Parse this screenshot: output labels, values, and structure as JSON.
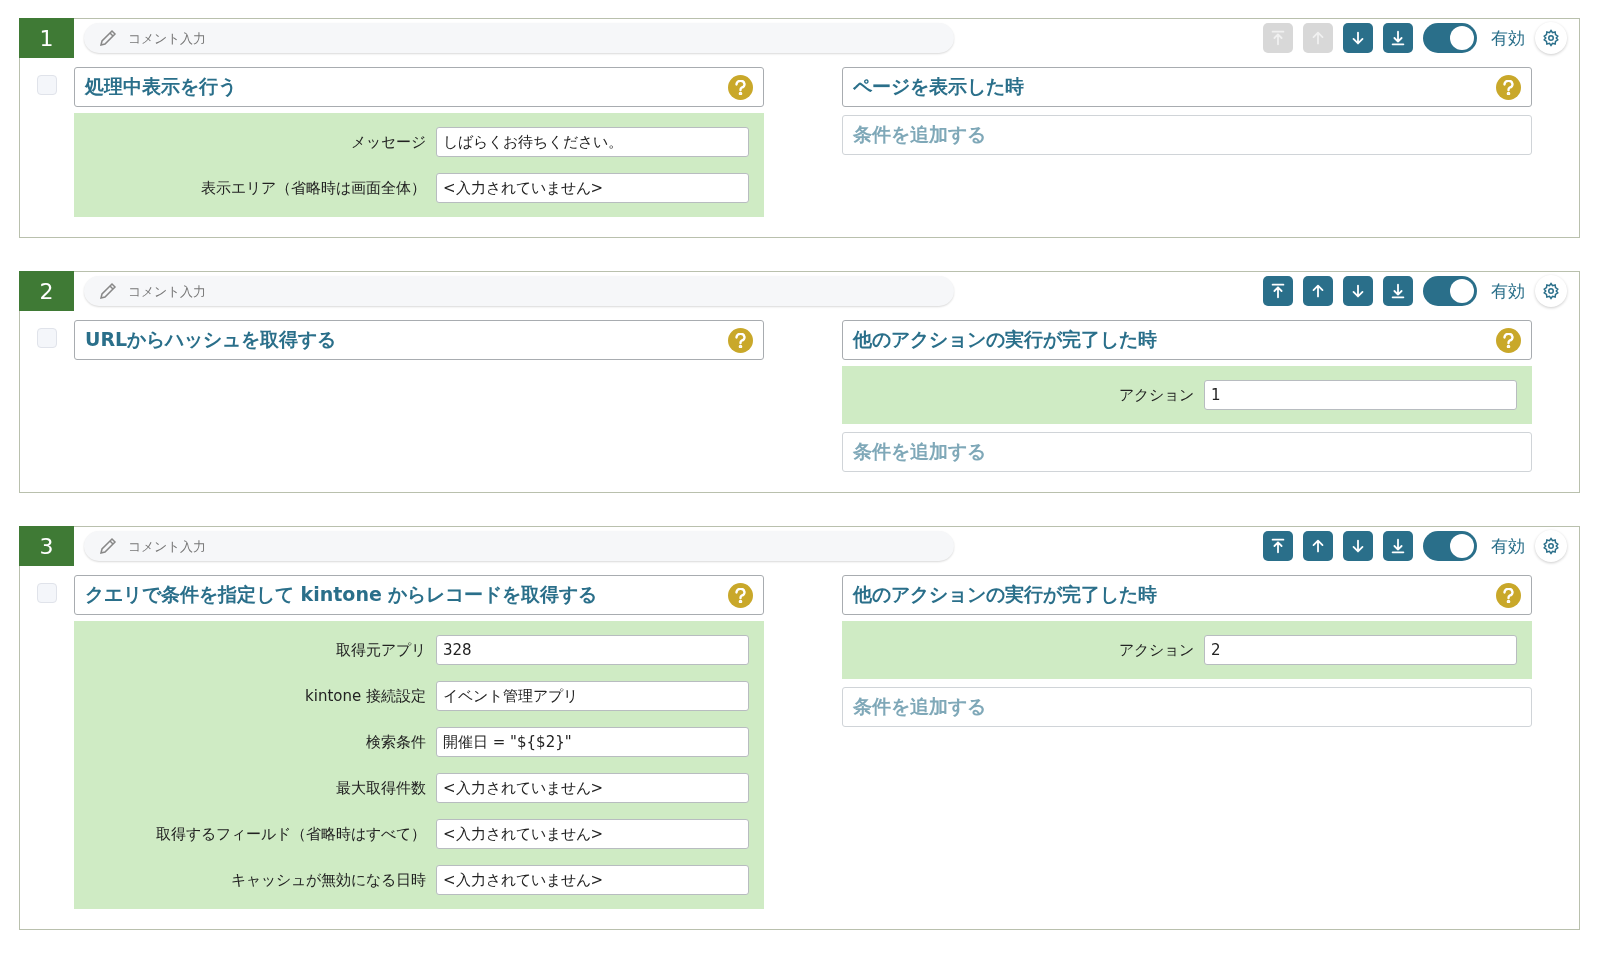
{
  "rules": [
    {
      "number": "1",
      "comment": {
        "placeholder": "コメント入力"
      },
      "move_buttons": [
        {
          "kind": "top",
          "disabled": true
        },
        {
          "kind": "up",
          "disabled": true
        },
        {
          "kind": "down",
          "disabled": false
        },
        {
          "kind": "bottom",
          "disabled": false
        }
      ],
      "enabled": {
        "on": true,
        "label": "有効"
      },
      "checked": false,
      "action": {
        "title": "処理中表示を行う",
        "params": [
          {
            "label": "メッセージ",
            "value": "しばらくお待ちください。"
          },
          {
            "label": "表示エリア（省略時は画面全体）",
            "value": "<入力されていません>"
          }
        ]
      },
      "trigger": {
        "title": "ページを表示した時",
        "add_condition": "条件を追加する"
      }
    },
    {
      "number": "2",
      "comment": {
        "placeholder": "コメント入力"
      },
      "move_buttons": [
        {
          "kind": "top",
          "disabled": false
        },
        {
          "kind": "up",
          "disabled": false
        },
        {
          "kind": "down",
          "disabled": false
        },
        {
          "kind": "bottom",
          "disabled": false
        }
      ],
      "enabled": {
        "on": true,
        "label": "有効"
      },
      "checked": false,
      "action": {
        "title": "URLからハッシュを取得する"
      },
      "trigger": {
        "title": "他のアクションの実行が完了した時",
        "params": [
          {
            "label": "アクション",
            "value": "1"
          }
        ],
        "add_condition": "条件を追加する"
      }
    },
    {
      "number": "3",
      "comment": {
        "placeholder": "コメント入力"
      },
      "move_buttons": [
        {
          "kind": "top",
          "disabled": false
        },
        {
          "kind": "up",
          "disabled": false
        },
        {
          "kind": "down",
          "disabled": false
        },
        {
          "kind": "bottom",
          "disabled": false
        }
      ],
      "enabled": {
        "on": true,
        "label": "有効"
      },
      "checked": false,
      "action": {
        "title": "クエリで条件を指定して kintone からレコードを取得する",
        "params": [
          {
            "label": "取得元アプリ",
            "value": "328"
          },
          {
            "label": "kintone 接続設定",
            "value": "イベント管理アプリ"
          },
          {
            "label": "検索条件",
            "value": "開催日 = \"${$2}\""
          },
          {
            "label": "最大取得件数",
            "value": "<入力されていません>"
          },
          {
            "label": "取得するフィールド（省略時はすべて）",
            "value": "<入力されていません>"
          },
          {
            "label": "キャッシュが無効になる日時",
            "value": "<入力されていません>"
          }
        ]
      },
      "trigger": {
        "title": "他のアクションの実行が完了した時",
        "params": [
          {
            "label": "アクション",
            "value": "2"
          }
        ],
        "add_condition": "条件を追加する"
      }
    }
  ]
}
